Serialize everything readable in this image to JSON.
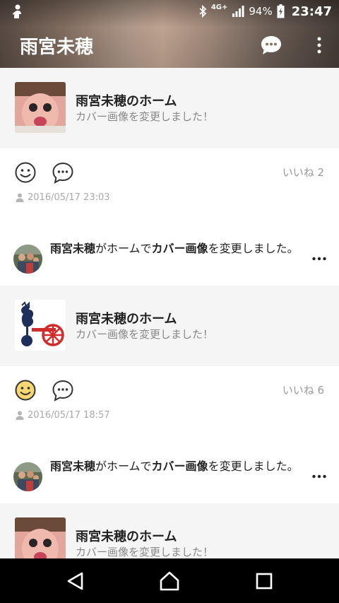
{
  "status_bar": {
    "network": "4G+",
    "battery": "94%",
    "time": "23:47"
  },
  "header": {
    "title": "雨宮未穂"
  },
  "feed": [
    {
      "type": "cover-change",
      "share": {
        "name": "雨宮未穂のホーム",
        "text": "カバー画像を変更しました！",
        "thumb": "pink-face-photo"
      },
      "likes": "いいね 2",
      "timestamp": "2016/05/17 23:03",
      "liked": false
    },
    {
      "type": "notice",
      "text_parts": [
        {
          "t": "雨宮未穂",
          "b": true
        },
        {
          "t": "がホームで",
          "b": false
        },
        {
          "t": "カバー画像",
          "b": true
        },
        {
          "t": "を変更しました。",
          "b": false
        }
      ]
    },
    {
      "type": "cover-change",
      "share": {
        "name": "雨宮未穂のホーム",
        "text": "カバー画像を変更しました！",
        "thumb": "cockerel-crest"
      },
      "likes": "いいね 6",
      "timestamp": "2016/05/17 18:57",
      "liked": true
    },
    {
      "type": "notice",
      "text_parts": [
        {
          "t": "雨宮未穂",
          "b": true
        },
        {
          "t": "がホームで",
          "b": false
        },
        {
          "t": "カバー画像",
          "b": true
        },
        {
          "t": "を変更しました。",
          "b": false
        }
      ]
    },
    {
      "type": "cover-change-partial",
      "share": {
        "name": "雨宮未穂のホーム",
        "text": "カバー画像を変更しました！",
        "thumb": "pink-face-photo"
      }
    }
  ],
  "colors": {
    "smile_liked_fill": "#f7d774",
    "meta_gray": "#aaaaaa",
    "card_bg": "#f5f5f5"
  },
  "icons": {
    "notification": "person-silhouette-icon",
    "bluetooth": "bluetooth-icon",
    "signal": "signal-icon",
    "battery": "battery-charging-icon",
    "chat": "chat-bubble-icon",
    "more": "more-vertical-icon",
    "smile": "smile-icon",
    "comment": "comment-icon",
    "author": "person-icon",
    "nav_back": "back-triangle-icon",
    "nav_home": "home-icon",
    "nav_recents": "recents-square-icon"
  }
}
